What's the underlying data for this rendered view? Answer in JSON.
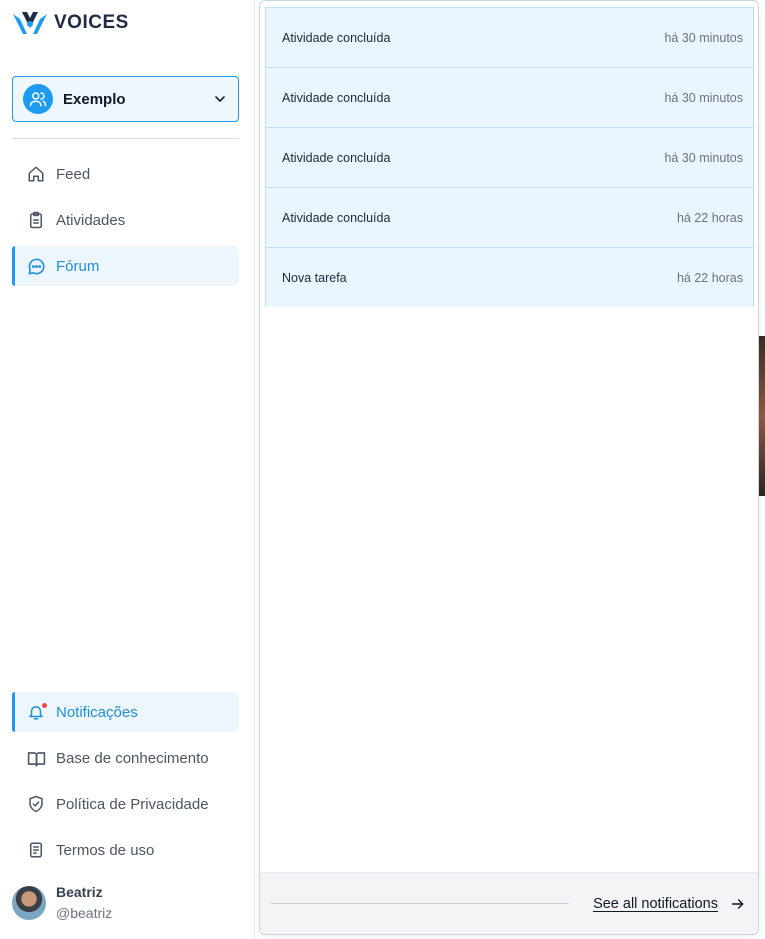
{
  "brand": {
    "name": "VOICES"
  },
  "workspace": {
    "name": "Exemplo"
  },
  "nav": {
    "feed": "Feed",
    "atividades": "Atividades",
    "forum": "Fórum",
    "notificacoes": "Notificações",
    "base": "Base de conhecimento",
    "politica": "Política de Privacidade",
    "termos": "Termos de uso"
  },
  "user": {
    "name": "Beatriz",
    "handle": "@beatriz"
  },
  "notifications": [
    {
      "title": "Atividade concluída",
      "time": "há 30 minutos"
    },
    {
      "title": "Atividade concluída",
      "time": "há 30 minutos"
    },
    {
      "title": "Atividade concluída",
      "time": "há 30 minutos"
    },
    {
      "title": "Atividade concluída",
      "time": "há 22 horas"
    },
    {
      "title": "Nova tarefa",
      "time": "há 22 horas"
    }
  ],
  "footer": {
    "see_all": "See all notifications"
  },
  "colors": {
    "accent": "#1d9bf0",
    "notif_bg": "#eaf6fd",
    "badge": "#ef4444"
  }
}
